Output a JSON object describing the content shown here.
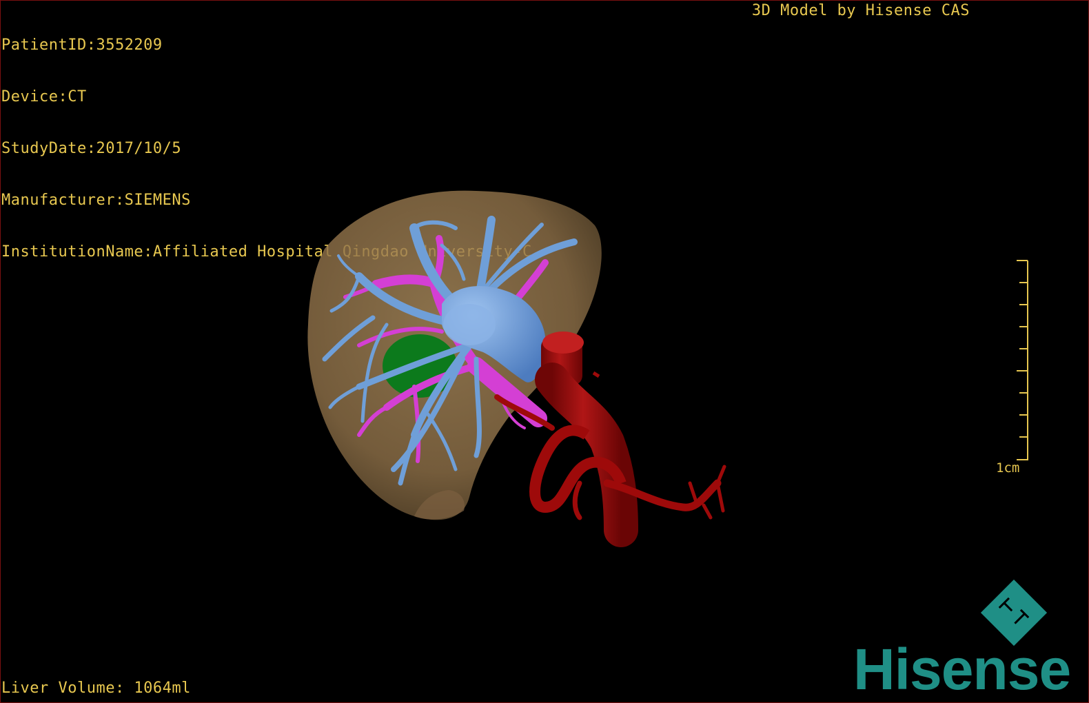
{
  "overlay": {
    "patient_id": "PatientID:3552209",
    "device": "Device:CT",
    "study_date": "StudyDate:2017/10/5",
    "manufacturer": "Manufacturer:SIEMENS",
    "institution": "InstitutionName:Affiliated Hospital Qingdao University-C",
    "credit": "3D Model by Hisense CAS",
    "liver_volume": "Liver Volume: 1064ml"
  },
  "scale": {
    "label": "1cm"
  },
  "brand": {
    "name": "Hisense"
  },
  "colors": {
    "text": "#e8c850",
    "liver": "#9b7b4e",
    "hepatic_vein": "#6f9fd8",
    "portal_vein": "#d43fd4",
    "gallbladder": "#0c7a1c",
    "artery": "#9e0a0a",
    "brand": "#1f8f86"
  }
}
